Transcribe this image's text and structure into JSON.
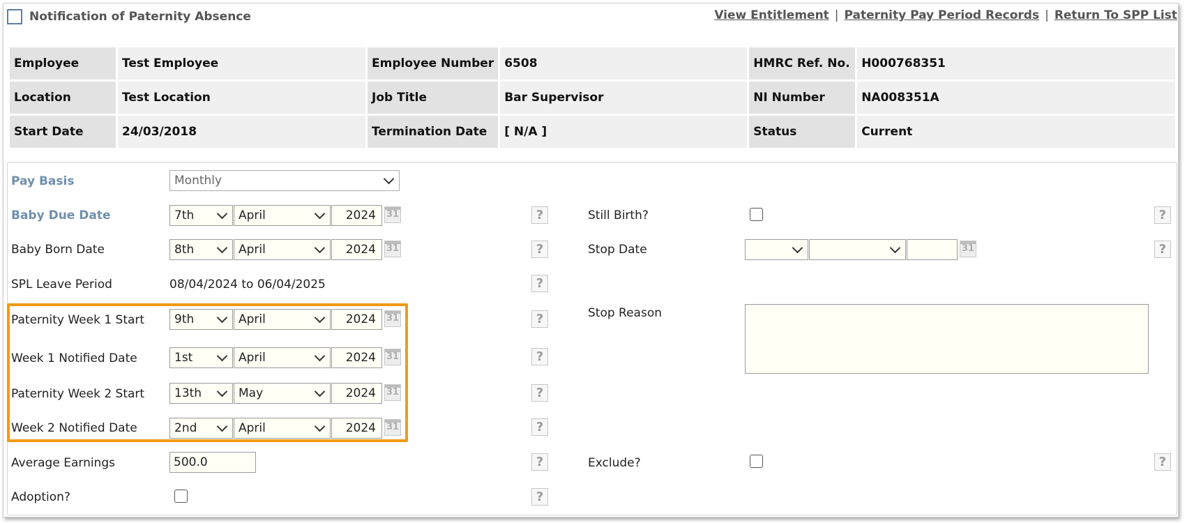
{
  "header": {
    "title": "Notification of Paternity Absence",
    "links": [
      "View Entitlement",
      "Paternity Pay Period Records",
      "Return To SPP List"
    ],
    "separator": "|"
  },
  "employee": {
    "rows": [
      [
        {
          "label": "Employee",
          "value": "Test Employee"
        },
        {
          "label": "Employee Number",
          "value": "6508"
        },
        {
          "label": "HMRC Ref. No.",
          "value": "H000768351"
        }
      ],
      [
        {
          "label": "Location",
          "value": "Test Location"
        },
        {
          "label": "Job Title",
          "value": "Bar Supervisor"
        },
        {
          "label": "NI Number",
          "value": "NA008351A"
        }
      ],
      [
        {
          "label": "Start Date",
          "value": "24/03/2018"
        },
        {
          "label": "Termination Date",
          "value": "[ N/A ]"
        },
        {
          "label": "Status",
          "value": "Current"
        }
      ]
    ]
  },
  "form": {
    "pay_basis": {
      "label": "Pay Basis",
      "value": "Monthly"
    },
    "baby_due": {
      "label": "Baby Due Date",
      "day": "7th",
      "month": "April",
      "year": "2024"
    },
    "baby_born": {
      "label": "Baby Born Date",
      "day": "8th",
      "month": "April",
      "year": "2024"
    },
    "spl_leave": {
      "label": "SPL Leave Period",
      "value": "08/04/2024 to 06/04/2025"
    },
    "week1_start": {
      "label": "Paternity Week 1 Start",
      "day": "9th",
      "month": "April",
      "year": "2024"
    },
    "week1_notified": {
      "label": "Week 1 Notified Date",
      "day": "1st",
      "month": "April",
      "year": "2024"
    },
    "week2_start": {
      "label": "Paternity Week 2 Start",
      "day": "13th",
      "month": "May",
      "year": "2024"
    },
    "week2_notified": {
      "label": "Week 2 Notified Date",
      "day": "2nd",
      "month": "April",
      "year": "2024"
    },
    "avg_earnings": {
      "label": "Average Earnings",
      "value": "500.0"
    },
    "adoption": {
      "label": "Adoption?"
    },
    "still_birth": {
      "label": "Still Birth?"
    },
    "stop_date": {
      "label": "Stop Date",
      "day": "",
      "month": "",
      "year": ""
    },
    "stop_reason": {
      "label": "Stop Reason"
    },
    "exclude": {
      "label": "Exclude?"
    }
  },
  "icons": {
    "calendar": "31",
    "help": "?"
  },
  "colors": {
    "highlight": "#f39a12",
    "label_blue": "#6f8fae"
  }
}
